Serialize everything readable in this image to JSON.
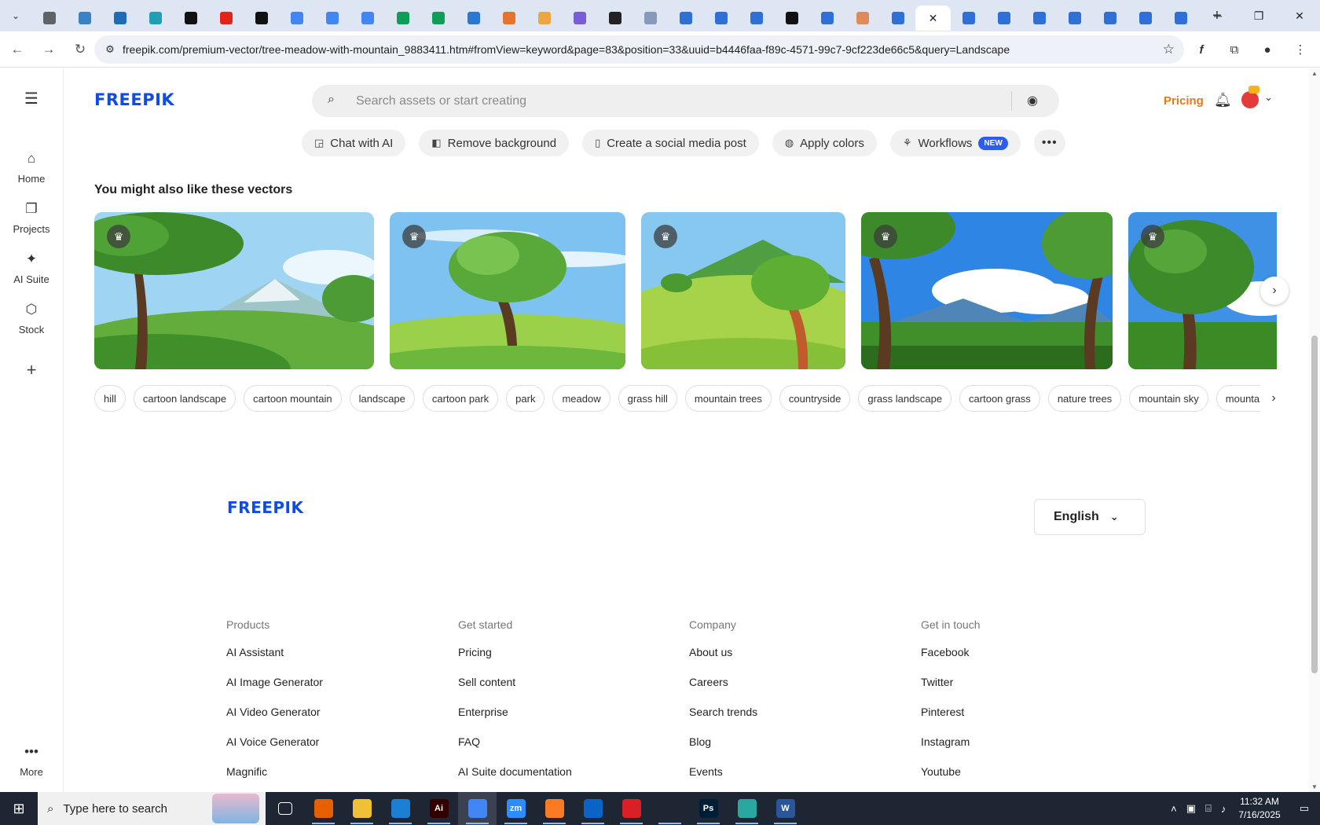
{
  "browser": {
    "tabs": [
      {
        "icon": "chat-icon",
        "color": "#5f6368"
      },
      {
        "icon": "globe-icon",
        "color": "#3b82c4"
      },
      {
        "icon": "vpn-icon",
        "color": "#1e6bb8"
      },
      {
        "icon": "play-icon",
        "color": "#1e9fb3"
      },
      {
        "icon": "openai-icon",
        "color": "#111111"
      },
      {
        "icon": "youtube-icon",
        "color": "#e62117"
      },
      {
        "icon": "bolt-icon",
        "color": "#111111"
      },
      {
        "icon": "docs-icon",
        "color": "#4285f4"
      },
      {
        "icon": "docs-icon",
        "color": "#4285f4"
      },
      {
        "icon": "docs-icon",
        "color": "#4285f4"
      },
      {
        "icon": "sheets-icon",
        "color": "#0f9d58"
      },
      {
        "icon": "sheets-icon",
        "color": "#0f9d58"
      },
      {
        "icon": "translate-icon",
        "color": "#2a78d4"
      },
      {
        "icon": "code-icon",
        "color": "#e8712c"
      },
      {
        "icon": "vue-icon",
        "color": "#f0a640"
      },
      {
        "icon": "braces-icon",
        "color": "#7b5cd6"
      },
      {
        "icon": "figure-icon",
        "color": "#222222"
      },
      {
        "icon": "slides-icon",
        "color": "#8899bb"
      },
      {
        "icon": "forms-icon",
        "color": "#2f6fd8"
      },
      {
        "icon": "forms-icon",
        "color": "#2f6fd8"
      },
      {
        "icon": "forms-icon",
        "color": "#2f6fd8"
      },
      {
        "icon": "medium-icon",
        "color": "#111111"
      },
      {
        "icon": "forms-icon",
        "color": "#2f6fd8"
      },
      {
        "icon": "claude-icon",
        "color": "#e08a5a"
      },
      {
        "icon": "forms-icon",
        "color": "#2f6fd8"
      },
      {
        "icon": "close-icon",
        "color": "#ffffff",
        "active": true
      },
      {
        "icon": "forms-icon",
        "color": "#2f6fd8"
      },
      {
        "icon": "forms-icon",
        "color": "#2f6fd8"
      },
      {
        "icon": "forms-icon",
        "color": "#2f6fd8"
      },
      {
        "icon": "forms-icon",
        "color": "#2f6fd8"
      },
      {
        "icon": "forms-icon",
        "color": "#2f6fd8"
      },
      {
        "icon": "forms-icon",
        "color": "#2f6fd8"
      },
      {
        "icon": "forms-icon",
        "color": "#2f6fd8"
      }
    ],
    "url": "freepik.com/premium-vector/tree-meadow-with-mountain_9883411.htm#fromView=keyword&page=83&position=33&uuid=b4446faa-f89c-4571-99c7-9cf223de66c5&query=Landscape"
  },
  "header": {
    "logo": "FREEPIK",
    "search_placeholder": "Search assets or start creating",
    "pricing": "Pricing"
  },
  "sidebar": {
    "items": [
      {
        "label": "Home",
        "icon": "home-icon"
      },
      {
        "label": "Projects",
        "icon": "projects-icon"
      },
      {
        "label": "AI Suite",
        "icon": "sparkle-icon"
      },
      {
        "label": "Stock",
        "icon": "stock-icon"
      }
    ],
    "more": "More"
  },
  "tools": [
    {
      "label": "Chat with AI",
      "icon": "chat-icon"
    },
    {
      "label": "Remove background",
      "icon": "remove-bg-icon"
    },
    {
      "label": "Create a social media post",
      "icon": "phone-icon"
    },
    {
      "label": "Apply colors",
      "icon": "palette-icon"
    },
    {
      "label": "Workflows",
      "icon": "workflow-icon",
      "badge": "NEW"
    }
  ],
  "related": {
    "title": "You might also like these vectors",
    "items": [
      {
        "name": "tree-mountain-meadow",
        "sky": "#8fcbf0",
        "ground": "#5aa63a"
      },
      {
        "name": "single-tree-field",
        "sky": "#6cb7ef",
        "ground": "#8dc63f"
      },
      {
        "name": "tree-green-hills",
        "sky": "#7ec3ee",
        "ground": "#9ccf44"
      },
      {
        "name": "trees-blue-mountains",
        "sky": "#2a7ee0",
        "ground": "#3f8f2a"
      },
      {
        "name": "tree-close-up",
        "sky": "#3c8fe6",
        "ground": "#2f7d22"
      }
    ]
  },
  "tags": [
    "hill",
    "cartoon landscape",
    "cartoon mountain",
    "landscape",
    "cartoon park",
    "park",
    "meadow",
    "grass hill",
    "mountain trees",
    "countryside",
    "grass landscape",
    "cartoon grass",
    "nature trees",
    "mountain sky",
    "mountain"
  ],
  "footer": {
    "logo": "FREEPIK",
    "language": "English",
    "columns": [
      {
        "heading": "Products",
        "links": [
          "AI Assistant",
          "AI Image Generator",
          "AI Video Generator",
          "AI Voice Generator",
          "Magnific"
        ]
      },
      {
        "heading": "Get started",
        "links": [
          "Pricing",
          "Sell content",
          "Enterprise",
          "FAQ",
          "AI Suite documentation"
        ]
      },
      {
        "heading": "Company",
        "links": [
          "About us",
          "Careers",
          "Search trends",
          "Blog",
          "Events"
        ]
      },
      {
        "heading": "Get in touch",
        "links": [
          "Facebook",
          "Twitter",
          "Pinterest",
          "Instagram",
          "Youtube"
        ]
      }
    ]
  },
  "taskbar": {
    "search_placeholder": "Type here to search",
    "apps": [
      {
        "name": "task-view",
        "label": "",
        "color": "#1f2633"
      },
      {
        "name": "firefox",
        "label": "",
        "color": "#e66000"
      },
      {
        "name": "file-explorer",
        "label": "",
        "color": "#f2c037"
      },
      {
        "name": "vscode",
        "label": "",
        "color": "#1b7fd6"
      },
      {
        "name": "illustrator",
        "label": "Ai",
        "color": "#330000"
      },
      {
        "name": "chrome",
        "label": "",
        "color": "#4285f4",
        "active": true
      },
      {
        "name": "zoom",
        "label": "zm",
        "color": "#2d8cff"
      },
      {
        "name": "xampp",
        "label": "",
        "color": "#fb7a24"
      },
      {
        "name": "outlook",
        "label": "",
        "color": "#0a64c8"
      },
      {
        "name": "creative-cloud",
        "label": "",
        "color": "#da1f26"
      },
      {
        "name": "pen-tool",
        "label": "",
        "color": "#1f2633"
      },
      {
        "name": "photoshop",
        "label": "Ps",
        "color": "#001e36"
      },
      {
        "name": "app-diamond",
        "label": "",
        "color": "#2aa7a0"
      },
      {
        "name": "word",
        "label": "W",
        "color": "#2b579a"
      }
    ],
    "time": "11:32 AM",
    "date": "7/16/2025"
  }
}
